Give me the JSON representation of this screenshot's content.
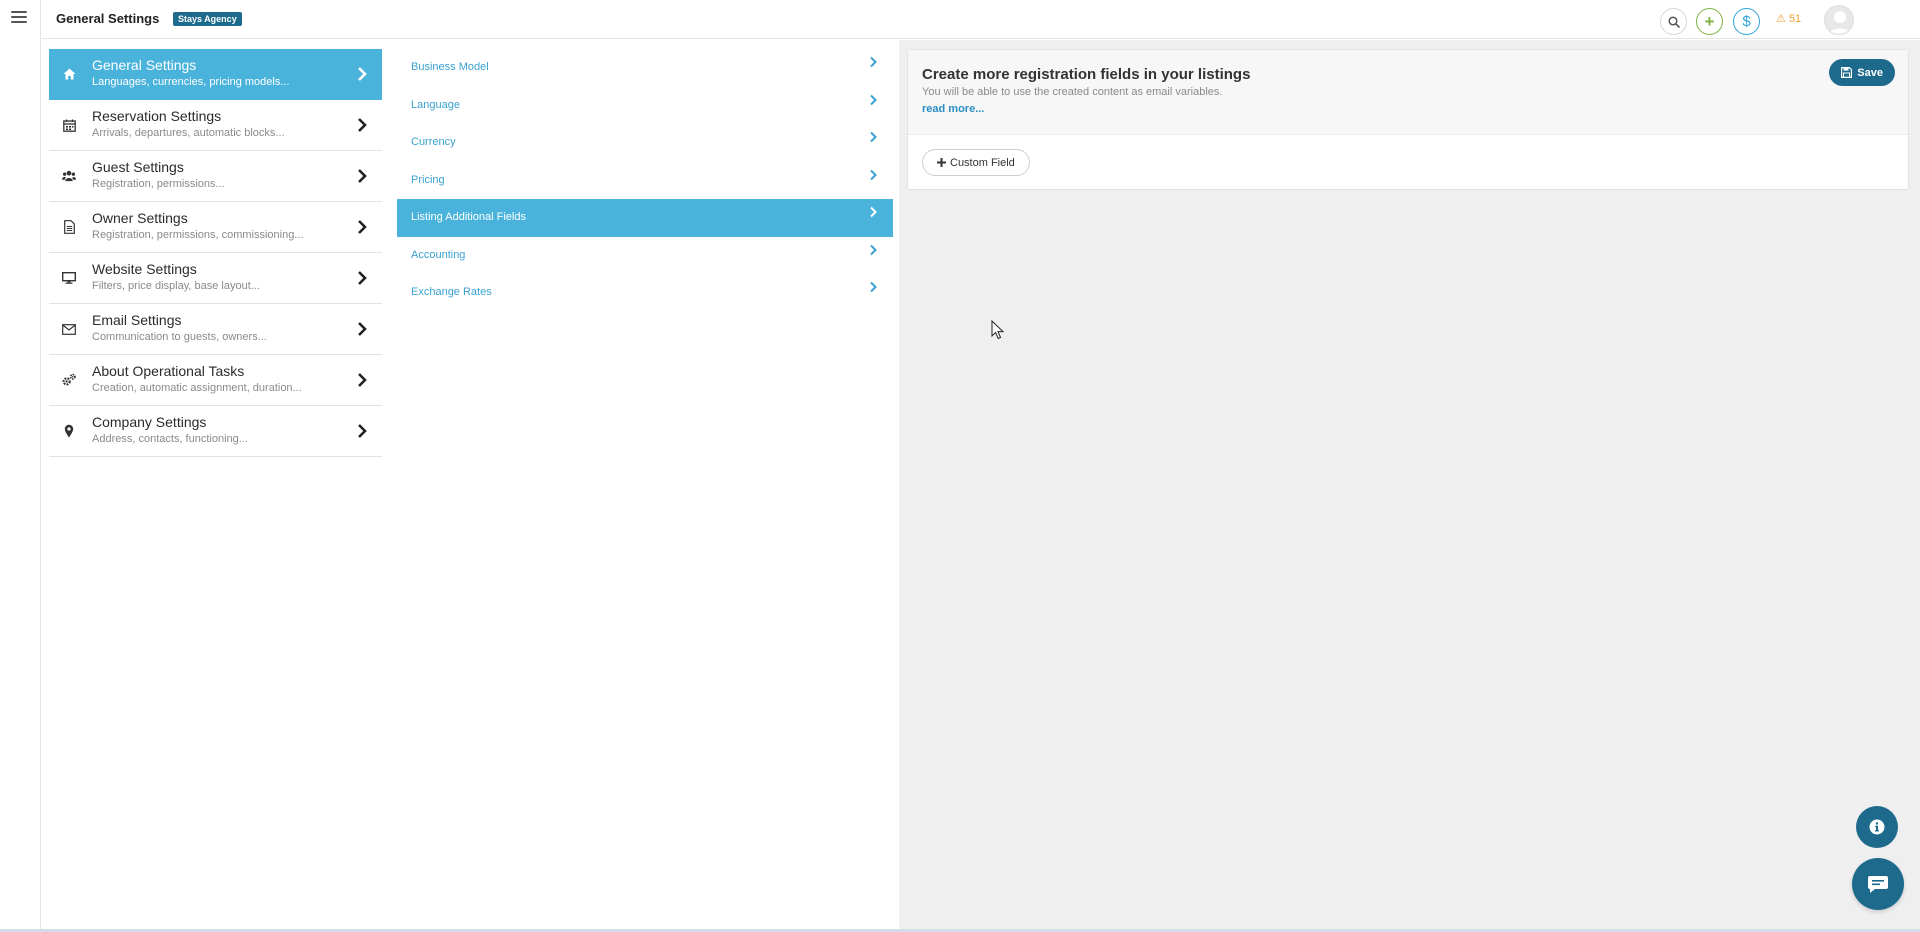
{
  "header": {
    "title": "General Settings",
    "badge": "Stays Agency",
    "alert_count": "51"
  },
  "menu": [
    {
      "title": "General Settings",
      "subtitle": "Languages, currencies, pricing models...",
      "icon": "home-icon",
      "active": true
    },
    {
      "title": "Reservation Settings",
      "subtitle": "Arrivals, departures, automatic blocks...",
      "icon": "calendar-icon"
    },
    {
      "title": "Guest Settings",
      "subtitle": "Registration, permissions...",
      "icon": "users-icon"
    },
    {
      "title": "Owner Settings",
      "subtitle": "Registration, permissions, commissioning...",
      "icon": "document-icon"
    },
    {
      "title": "Website Settings",
      "subtitle": "Filters, price display, base layout...",
      "icon": "monitor-icon"
    },
    {
      "title": "Email Settings",
      "subtitle": "Communication to guests, owners...",
      "icon": "envelope-icon"
    },
    {
      "title": "About Operational Tasks",
      "subtitle": "Creation, automatic assignment, duration...",
      "icon": "gears-icon"
    },
    {
      "title": "Company Settings",
      "subtitle": "Address, contacts, functioning...",
      "icon": "map-pin-icon"
    }
  ],
  "submenu": [
    {
      "label": "Business Model"
    },
    {
      "label": "Language"
    },
    {
      "label": "Currency"
    },
    {
      "label": "Pricing"
    },
    {
      "label": "Listing Additional Fields",
      "active": true
    },
    {
      "label": "Accounting"
    },
    {
      "label": "Exchange Rates"
    }
  ],
  "panel": {
    "title": "Create more registration fields in your listings",
    "description": "You will be able to use the created content as email variables.",
    "read_more": "read more...",
    "save_label": "Save",
    "custom_field_label": "Custom Field"
  },
  "colors": {
    "accent": "#4ab3dc",
    "primary_dark": "#1d6a8c",
    "link": "#2a8fc4",
    "warning": "#f0a030",
    "success": "#7cb342"
  }
}
